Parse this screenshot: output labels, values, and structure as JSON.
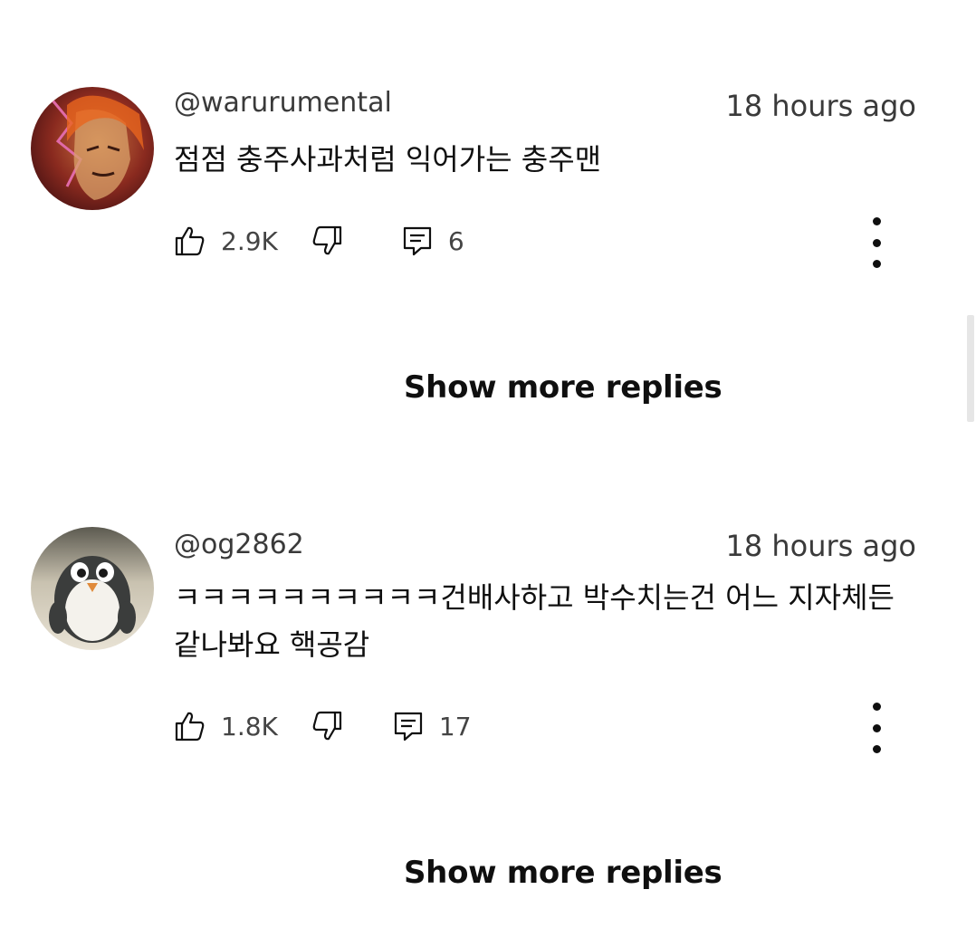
{
  "comments": [
    {
      "author": "@warurumental",
      "time": "18 hours ago",
      "text": "점점 충주사과처럼 익어가는 충주맨",
      "likes": "2.9K",
      "replies": "6",
      "show_more_label": "Show more replies",
      "avatar": "red-haired-character-avatar"
    },
    {
      "author": "@og2862",
      "time": "18 hours ago",
      "text": "ㅋㅋㅋㅋㅋㅋㅋㅋㅋㅋ건배사하고 박수치는건 어느 지자체든 같나봐요 핵공감",
      "likes": "1.8K",
      "replies": "17",
      "show_more_label": "Show more replies",
      "avatar": "penguin-avatar"
    }
  ],
  "icons": {
    "like": "thumbs-up-icon",
    "dislike": "thumbs-down-icon",
    "reply": "comment-icon",
    "menu": "more-vertical-icon"
  }
}
